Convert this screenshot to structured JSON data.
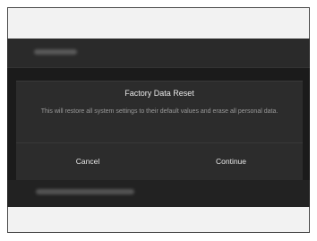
{
  "dialog": {
    "title": "Factory Data Reset",
    "message": "This will restore all system settings to their default values and erase all personal data.",
    "cancel_label": "Cancel",
    "continue_label": "Continue"
  }
}
